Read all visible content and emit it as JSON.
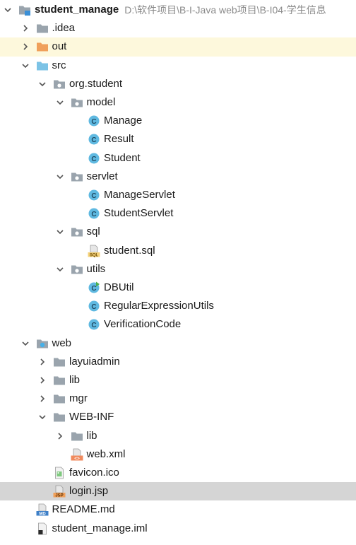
{
  "colors": {
    "selected_row": "#d5d5d5",
    "excluded_row": "#fdf8dc",
    "folder_gray": "#9aa4ad",
    "folder_orange": "#f0a05a",
    "folder_blue": "#7cc3e6",
    "class_icon": "#5fb9e1"
  },
  "tree": [
    {
      "label": "student_manage",
      "path": "D:\\软件项目\\B-I-Java web项目\\B-I04-学生信息",
      "depth": 0,
      "arrow": "down",
      "icon": "module-folder-icon",
      "bold": true
    },
    {
      "label": ".idea",
      "depth": 1,
      "arrow": "right",
      "icon": "folder-icon"
    },
    {
      "label": "out",
      "depth": 1,
      "arrow": "right",
      "icon": "excluded-folder-icon",
      "highlight": "excluded"
    },
    {
      "label": "src",
      "depth": 1,
      "arrow": "down",
      "icon": "source-folder-icon"
    },
    {
      "label": "org.student",
      "depth": 2,
      "arrow": "down",
      "icon": "package-icon"
    },
    {
      "label": "model",
      "depth": 3,
      "arrow": "down",
      "icon": "package-icon"
    },
    {
      "label": "Manage",
      "depth": 4,
      "arrow": "none",
      "icon": "class-icon"
    },
    {
      "label": "Result",
      "depth": 4,
      "arrow": "none",
      "icon": "class-icon"
    },
    {
      "label": "Student",
      "depth": 4,
      "arrow": "none",
      "icon": "class-icon"
    },
    {
      "label": "servlet",
      "depth": 3,
      "arrow": "down",
      "icon": "package-icon"
    },
    {
      "label": "ManageServlet",
      "depth": 4,
      "arrow": "none",
      "icon": "class-icon"
    },
    {
      "label": "StudentServlet",
      "depth": 4,
      "arrow": "none",
      "icon": "class-icon"
    },
    {
      "label": "sql",
      "depth": 3,
      "arrow": "down",
      "icon": "package-icon"
    },
    {
      "label": "student.sql",
      "depth": 4,
      "arrow": "none",
      "icon": "sql-file-icon"
    },
    {
      "label": "utils",
      "depth": 3,
      "arrow": "down",
      "icon": "package-icon"
    },
    {
      "label": "DBUtil",
      "depth": 4,
      "arrow": "none",
      "icon": "runnable-class-icon"
    },
    {
      "label": "RegularExpressionUtils",
      "depth": 4,
      "arrow": "none",
      "icon": "class-icon"
    },
    {
      "label": "VerificationCode",
      "depth": 4,
      "arrow": "none",
      "icon": "class-icon"
    },
    {
      "label": "web",
      "depth": 1,
      "arrow": "down",
      "icon": "web-folder-icon"
    },
    {
      "label": "layuiadmin",
      "depth": 2,
      "arrow": "right",
      "icon": "folder-icon"
    },
    {
      "label": "lib",
      "depth": 2,
      "arrow": "right",
      "icon": "folder-icon"
    },
    {
      "label": "mgr",
      "depth": 2,
      "arrow": "right",
      "icon": "folder-icon"
    },
    {
      "label": "WEB-INF",
      "depth": 2,
      "arrow": "down",
      "icon": "folder-icon"
    },
    {
      "label": "lib",
      "depth": 3,
      "arrow": "right",
      "icon": "folder-icon"
    },
    {
      "label": "web.xml",
      "depth": 3,
      "arrow": "none",
      "icon": "xml-file-icon"
    },
    {
      "label": "favicon.ico",
      "depth": 2,
      "arrow": "none",
      "icon": "image-file-icon"
    },
    {
      "label": "login.jsp",
      "depth": 2,
      "arrow": "none",
      "icon": "jsp-file-icon",
      "highlight": "selected"
    },
    {
      "label": "README.md",
      "depth": 1,
      "arrow": "none",
      "icon": "markdown-file-icon"
    },
    {
      "label": "student_manage.iml",
      "depth": 1,
      "arrow": "none",
      "icon": "iml-file-icon"
    }
  ]
}
